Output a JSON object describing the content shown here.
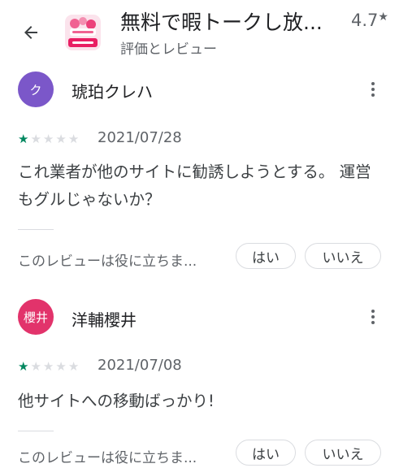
{
  "header": {
    "back_icon": "arrow-back-icon",
    "app_title": "無料で暇トークし放...",
    "subtitle": "評価とレビュー",
    "rating": "4.7",
    "rating_star": "★",
    "app_icon": "app-logo-icon"
  },
  "reviews": [
    {
      "avatar_text": "ク",
      "avatar_color": "#7b57c9",
      "name": "琥珀クレハ",
      "rating": 1,
      "date": "2021/07/28",
      "text": "これ業者が他のサイトに勧誘しようとする。 運営もグルじゃないか？",
      "helpful_prompt": "このレビューは役に立ちま...",
      "yes_label": "はい",
      "no_label": "いいえ"
    },
    {
      "avatar_text": "櫻井",
      "avatar_color": "#e2336b",
      "name": "洋輔櫻井",
      "rating": 1,
      "date": "2021/07/08",
      "text": "他サイトへの移動ばっかり!",
      "helpful_prompt": "このレビューは役に立ちま...",
      "yes_label": "はい",
      "no_label": "いいえ"
    }
  ],
  "colors": {
    "star_on": "#01875f",
    "star_off": "#dadce0",
    "text_secondary": "#5f6368"
  }
}
